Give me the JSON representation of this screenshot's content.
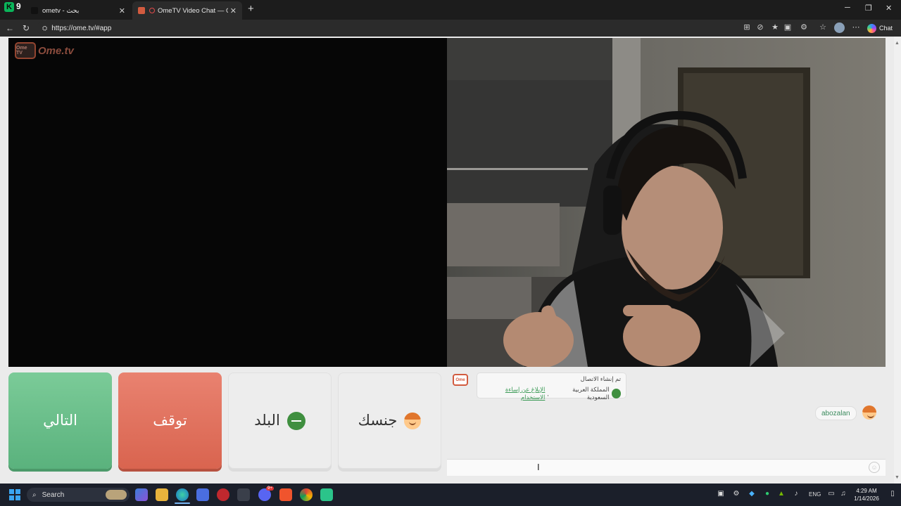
{
  "browser": {
    "tabs": [
      {
        "title": "ometv - بحث"
      },
      {
        "title": "OmeTV Video Chat — Omegle"
      }
    ],
    "url": "https://ome.tv/#app",
    "chat_label": "Chat",
    "launcher_number": "9"
  },
  "app": {
    "logo_text": "Ome.tv",
    "logo_badge": "Ome TV",
    "buttons": {
      "next": "التالي",
      "stop": "توقف",
      "country": "البلد",
      "gender": "جنسك"
    },
    "chat": {
      "system_line1": "تم إنشاء الاتصال",
      "system_country": "المملكة العربية السعودية",
      "system_report_link": "الإبلاغ عن إساءة الاستخدام",
      "user_name": "abozalan"
    },
    "colors": {
      "next": "#66bb88",
      "stop": "#e0705b",
      "link": "#3a9a55"
    }
  },
  "taskbar": {
    "search_placeholder": "Search",
    "language": "ENG",
    "time": "4:29 AM",
    "date": "1/14/2026",
    "discord_badge": "9+"
  }
}
